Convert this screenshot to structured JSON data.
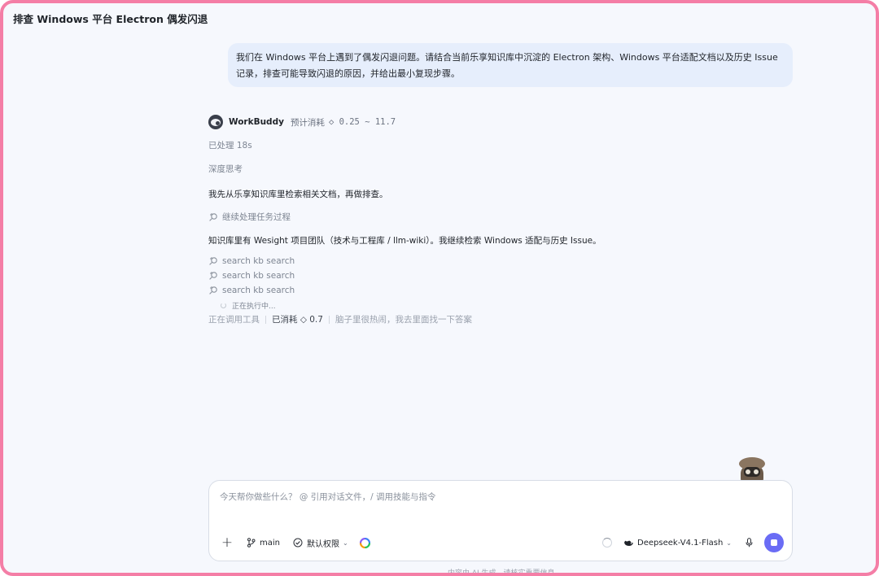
{
  "window": {
    "title": "排查 Windows 平台 Electron 偶发闪退"
  },
  "user_message": {
    "text": "我们在 Windows 平台上遇到了偶发闪退问题。请结合当前乐享知识库中沉淀的 Electron 架构、Windows 平台适配文档以及历史 Issue 记录，排查可能导致闪退的原因，并给出最小复现步骤。"
  },
  "assistant": {
    "name": "WorkBuddy",
    "cost_label": "预计消耗",
    "cost_range": "◇ 0.25 ~ 11.7",
    "processed": "已处理 18s",
    "deep_thinking": "深度思考",
    "reply_1": "我先从乐享知识库里检索相关文档，再做排查。",
    "continue_task": "继续处理任务过程",
    "reply_2": "知识库里有 Wesight 项目团队（技术与工程库 / llm-wiki）。我继续检索 Windows 适配与历史 Issue。",
    "tool_calls": [
      "search kb search",
      "search kb search",
      "search kb search"
    ],
    "executing": "正在执行中...",
    "status": {
      "calling_tools": "正在调用工具",
      "consumed": "已消耗 ◇ 0.7",
      "flavor": "脑子里很热闹，我去里面找一下答案"
    }
  },
  "composer": {
    "placeholder": "今天帮你做些什么？ @ 引用对话文件，/ 调用技能与指令",
    "plus": "+",
    "branch": "main",
    "permission": "默认权限",
    "model": "Deepseek-V4.1-Flash"
  },
  "footer": {
    "note": "内容由 AI 生成，请核实重要信息"
  },
  "colors": {
    "frame": "#f47ea6",
    "accent": "#6a6cf5",
    "bubble": "#e6eefc",
    "background": "#f6f8fd"
  },
  "icons": {
    "tool": "search-history-icon",
    "branch": "git-branch-icon",
    "permission": "shield-check-icon",
    "logo": "colorful-ring-icon",
    "model": "whale-icon",
    "mic": "microphone-icon",
    "stop": "stop-icon"
  }
}
